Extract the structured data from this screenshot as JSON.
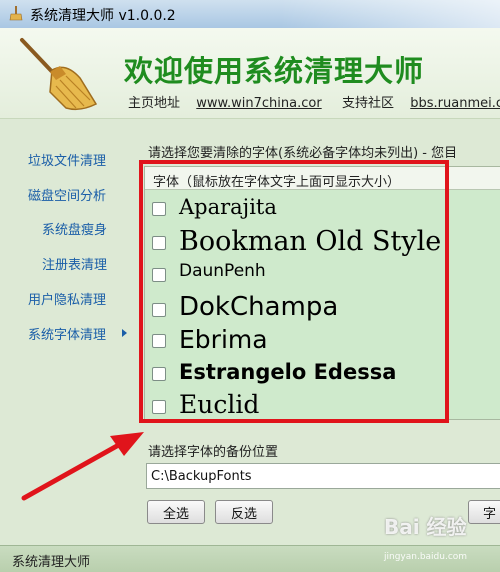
{
  "window": {
    "title": "系统清理大师 v1.0.0.2"
  },
  "header": {
    "welcome": "欢迎使用系统清理大师",
    "homepage_label": "主页地址",
    "homepage_link": "www.win7china.cor",
    "community_label": "支持社区",
    "community_link": "bbs.ruanmei.co"
  },
  "sidebar": {
    "items": [
      {
        "label": "垃圾文件清理"
      },
      {
        "label": "磁盘空间分析"
      },
      {
        "label": "系统盘瘦身"
      },
      {
        "label": "注册表清理"
      },
      {
        "label": "用户隐私清理"
      },
      {
        "label": "系统字体清理"
      }
    ]
  },
  "main": {
    "prompt": "请选择您要清除的字体(系统必备字体均未列出) - 您目",
    "list_header": "字体（鼠标放在字体文字上面可显示大小）",
    "fonts": [
      {
        "name": "Aparajita",
        "checked": false
      },
      {
        "name": "Bookman Old Style",
        "checked": false
      },
      {
        "name": "DaunPenh",
        "checked": false
      },
      {
        "name": "DokChampa",
        "checked": false
      },
      {
        "name": "Ebrima",
        "checked": false
      },
      {
        "name": "Estrangelo Edessa",
        "checked": false
      },
      {
        "name": "Euclid",
        "checked": false
      }
    ],
    "backup_label": "请选择字体的备份位置",
    "backup_path": "C:\\BackupFonts",
    "select_all_label": "全选",
    "invert_label": "反选",
    "right_button_label": "字"
  },
  "statusbar": {
    "text": "系统清理大师"
  },
  "watermark": {
    "logo": "Bai 经验",
    "url": "jingyan.baidu.com"
  },
  "colors": {
    "accent_green": "#1f8c1f",
    "nav_blue": "#1a5ea8",
    "highlight_red": "#e0141b",
    "list_bg": "#cfeacc"
  }
}
